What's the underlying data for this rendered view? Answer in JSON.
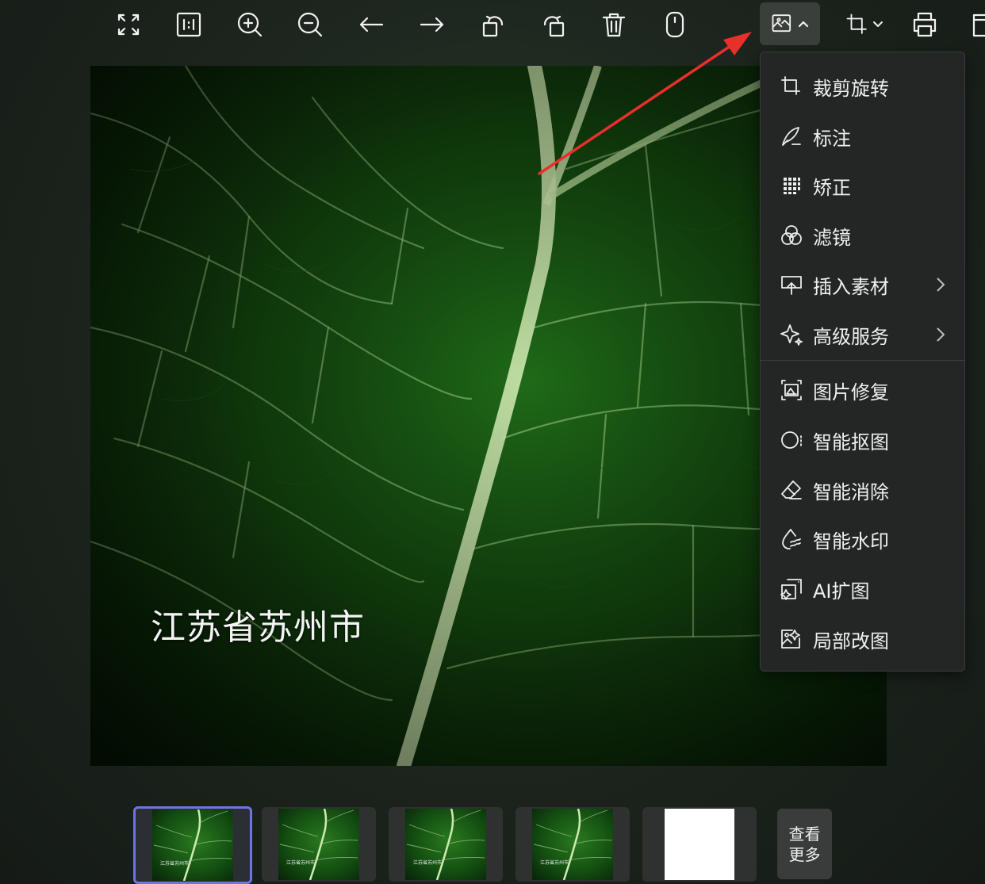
{
  "toolbar": {
    "buttons": [
      {
        "name": "fit-screen-icon"
      },
      {
        "name": "actual-size-icon"
      },
      {
        "name": "zoom-in-icon"
      },
      {
        "name": "zoom-out-icon"
      },
      {
        "name": "previous-icon"
      },
      {
        "name": "next-icon"
      },
      {
        "name": "rotate-left-icon"
      },
      {
        "name": "rotate-right-icon"
      },
      {
        "name": "delete-icon"
      },
      {
        "name": "mouse-icon"
      },
      {
        "name": "edit-image-icon"
      },
      {
        "name": "crop-icon"
      },
      {
        "name": "print-icon"
      },
      {
        "name": "folder-icon"
      }
    ]
  },
  "image": {
    "caption": "江苏省苏州市"
  },
  "edit_menu": {
    "items": [
      {
        "label": "裁剪旋转",
        "icon": "crop-rotate-icon"
      },
      {
        "label": "标注",
        "icon": "annotate-icon"
      },
      {
        "label": "矫正",
        "icon": "correct-icon"
      },
      {
        "label": "滤镜",
        "icon": "filter-icon"
      },
      {
        "label": "插入素材",
        "icon": "insert-material-icon",
        "submenu": true
      },
      {
        "label": "高级服务",
        "icon": "advanced-service-icon",
        "submenu": true
      },
      {
        "label": "图片修复",
        "icon": "image-repair-icon"
      },
      {
        "label": "智能抠图",
        "icon": "smart-cutout-icon"
      },
      {
        "label": "智能消除",
        "icon": "smart-erase-icon"
      },
      {
        "label": "智能水印",
        "icon": "smart-watermark-icon"
      },
      {
        "label": "AI扩图",
        "icon": "ai-expand-icon"
      },
      {
        "label": "局部改图",
        "icon": "partial-edit-icon"
      }
    ]
  },
  "thumbnails": {
    "items": [
      {
        "caption": "江苏省苏州市",
        "selected": true
      },
      {
        "caption": "江苏省苏州市",
        "selected": false
      },
      {
        "caption": "江苏省苏州市",
        "selected": false
      },
      {
        "caption": "江苏省苏州市",
        "selected": false
      },
      {
        "caption": "",
        "blank": true
      }
    ],
    "more_label_line1": "查看",
    "more_label_line2": "更多"
  },
  "colors": {
    "selected_border": "#6e74e0",
    "annotation_arrow": "#e8302a"
  }
}
